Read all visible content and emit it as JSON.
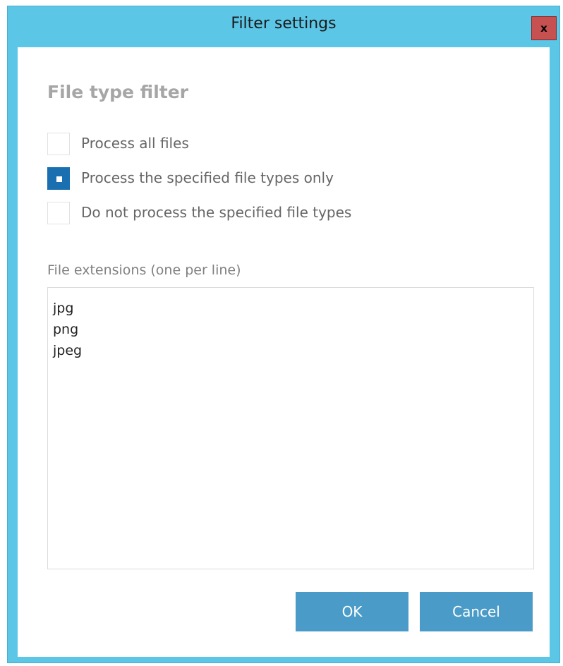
{
  "window": {
    "title": "Filter settings",
    "close_label": "x"
  },
  "filter": {
    "section_title": "File type filter",
    "options": [
      {
        "label": "Process all files",
        "checked": false
      },
      {
        "label": "Process the specified file types only",
        "checked": true
      },
      {
        "label": "Do not process the specified file types",
        "checked": false
      }
    ]
  },
  "extensions": {
    "label": "File extensions (one per line)",
    "value": "jpg\npng\njpeg"
  },
  "buttons": {
    "ok_label": "OK",
    "cancel_label": "Cancel"
  },
  "colors": {
    "titlebar": "#5cc6e6",
    "close": "#c75050",
    "selected": "#1a6fb0",
    "button": "#4a9bc7"
  }
}
